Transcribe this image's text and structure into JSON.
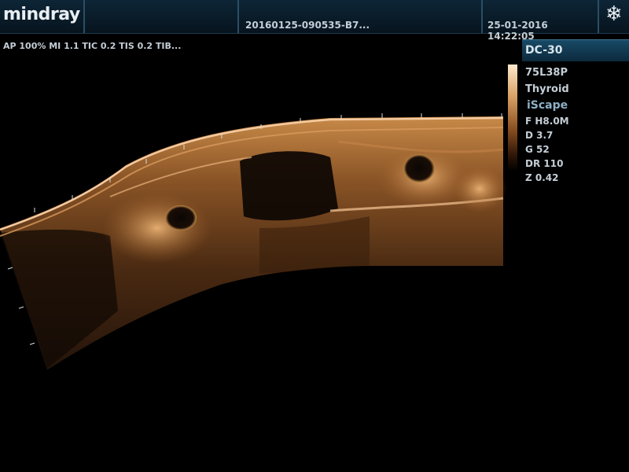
{
  "header": {
    "brand": "mindray",
    "patient_id": "20160125-090535-B7...",
    "datetime": "25-01-2016 14:22:05",
    "freeze_icon": "snowflake-icon"
  },
  "acoustic_output": "AP 100%  MI 1.1 TIC 0.2 TIS 0.2 TIB...",
  "probe_mode": "DC-30",
  "params": {
    "probe": "75L38P",
    "preset": "Thyroid",
    "mode": "iScape",
    "frequency": "F H8.0M",
    "depth": "D 3.7",
    "gain": "G 52",
    "dynamic_range": "DR 110",
    "zoom": "Z 0.42"
  },
  "colors": {
    "header_bg": "#0d2536",
    "accent_blue": "#184a66",
    "text": "#c4ced6",
    "tissue_tint": "#d8a064"
  }
}
